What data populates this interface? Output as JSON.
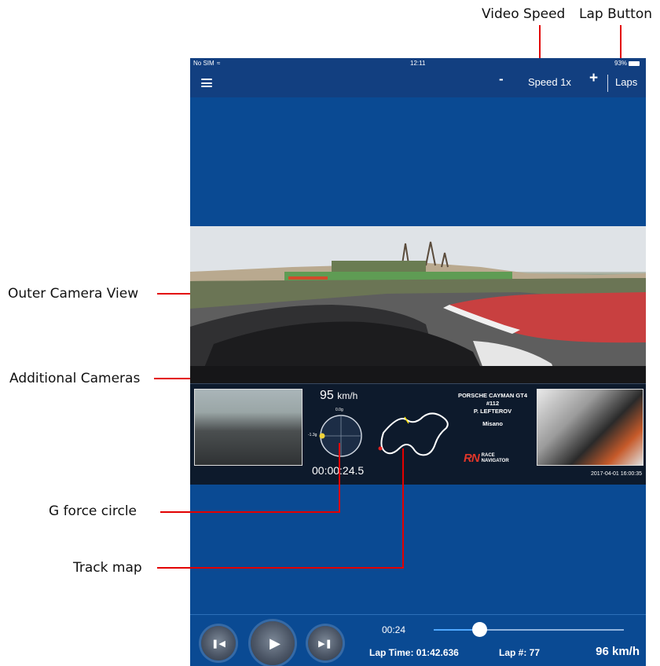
{
  "annotations": {
    "video_speed": "Video Speed",
    "lap_button": "Lap Button",
    "outer_camera": "Outer Camera View",
    "additional_cameras": "Additional Cameras",
    "g_force": "G force circle",
    "track_map": "Track map"
  },
  "status": {
    "carrier": "No SIM",
    "time": "12:11",
    "battery": "93%"
  },
  "navbar": {
    "minus": "-",
    "speed": "Speed 1x",
    "plus": "+",
    "laps": "Laps"
  },
  "overlay": {
    "speed_value": "95",
    "speed_unit": "km/h",
    "timer": "00:00:24.5",
    "g_top": "0.0g",
    "g_left": "-1.3g",
    "car": "PORSCHE CAYMAN GT4",
    "number": "#112",
    "driver": "P. LEFTEROV",
    "track": "Misano",
    "brand_mark": "RN",
    "brand_line1": "RACE",
    "brand_line2": "NAVIGATOR",
    "datetime": "2017-04-01 16:00:35"
  },
  "playback": {
    "current_time": "00:24",
    "progress_fraction": 0.24,
    "lap_time": "Lap Time: 01:42.636",
    "lap_number": "Lap #: 77",
    "speed": "96 km/h"
  }
}
